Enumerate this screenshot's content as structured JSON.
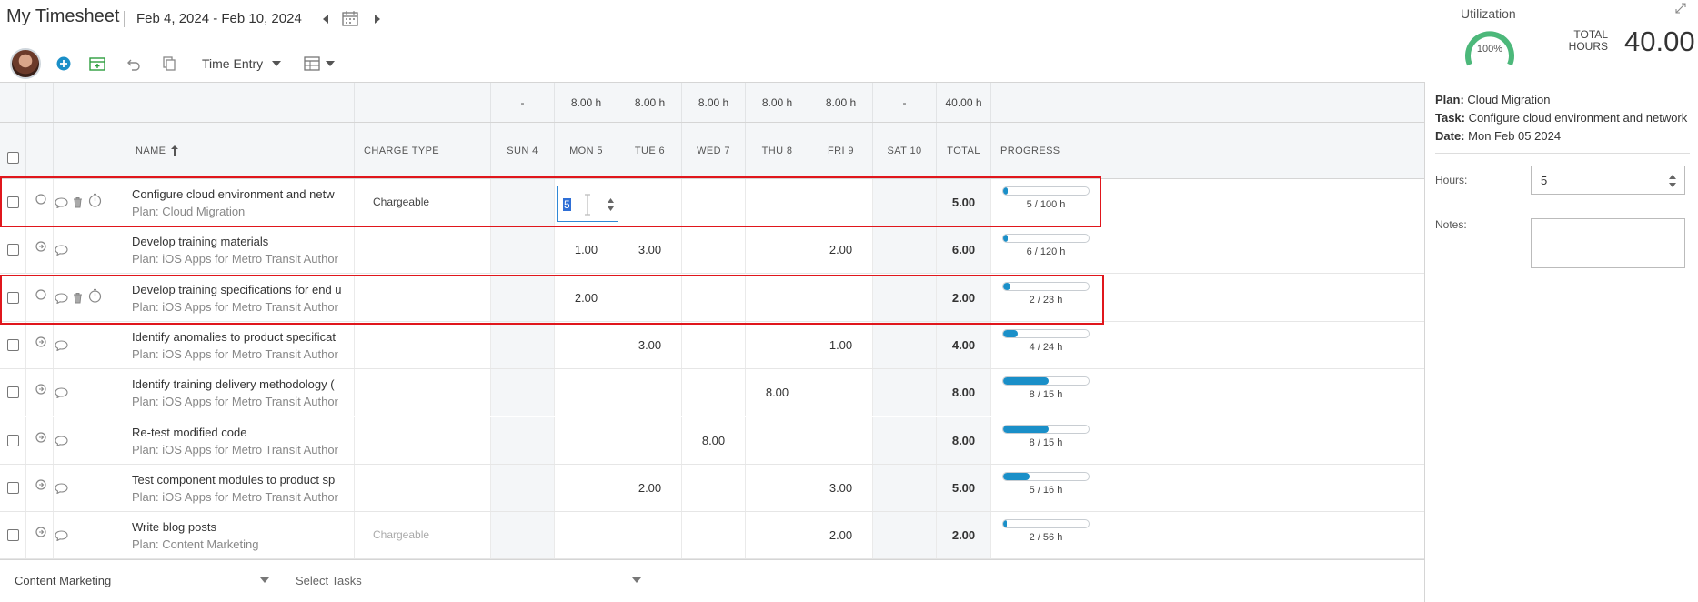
{
  "header": {
    "title": "My Timesheet",
    "date_range": "Feb 4, 2024 - Feb 10, 2024"
  },
  "toolbar": {
    "view_label": "Time Entry"
  },
  "utilization": {
    "label": "Utilization",
    "percent": "100%",
    "total_label_1": "TOTAL",
    "total_label_2": "HOURS",
    "total_value": "40.00"
  },
  "grid": {
    "day_totals": [
      "-",
      "8.00 h",
      "8.00 h",
      "8.00 h",
      "8.00 h",
      "8.00 h",
      "-",
      "40.00 h"
    ],
    "columns": {
      "name": "NAME",
      "charge_type": "CHARGE TYPE",
      "sun": "SUN 4",
      "mon": "MON 5",
      "tue": "TUE 6",
      "wed": "WED 7",
      "thu": "THU 8",
      "fri": "FRI 9",
      "sat": "SAT 10",
      "total": "TOTAL",
      "progress": "PROGRESS"
    },
    "rows": [
      {
        "name": "Configure cloud environment and netw",
        "plan": "Plan: Cloud Migration",
        "charge": "Chargeable",
        "mon": "5",
        "tue": "",
        "wed": "",
        "thu": "",
        "fri": "",
        "total": "5.00",
        "progress": "5 / 100 h",
        "progress_value": 0.05
      },
      {
        "name": "Develop training materials",
        "plan": "Plan: iOS Apps for Metro Transit Author",
        "charge": "",
        "mon": "1.00",
        "tue": "3.00",
        "wed": "",
        "thu": "",
        "fri": "2.00",
        "total": "6.00",
        "progress": "6 / 120 h",
        "progress_value": 0.05
      },
      {
        "name": "Develop training specifications for end u",
        "plan": "Plan: iOS Apps for Metro Transit Author",
        "charge": "",
        "mon": "2.00",
        "tue": "",
        "wed": "",
        "thu": "",
        "fri": "",
        "total": "2.00",
        "progress": "2 / 23 h",
        "progress_value": 0.087
      },
      {
        "name": "Identify anomalies to product specificat",
        "plan": "Plan: iOS Apps for Metro Transit Author",
        "charge": "",
        "mon": "",
        "tue": "3.00",
        "wed": "",
        "thu": "",
        "fri": "1.00",
        "total": "4.00",
        "progress": "4 / 24 h",
        "progress_value": 0.167
      },
      {
        "name": "Identify training delivery methodology (",
        "plan": "Plan: iOS Apps for Metro Transit Author",
        "charge": "",
        "mon": "",
        "tue": "",
        "wed": "",
        "thu": "8.00",
        "fri": "",
        "total": "8.00",
        "progress": "8 / 15 h",
        "progress_value": 0.533
      },
      {
        "name": "Re-test modified code",
        "plan": "Plan: iOS Apps for Metro Transit Author",
        "charge": "",
        "mon": "",
        "tue": "",
        "wed": "8.00",
        "thu": "",
        "fri": "",
        "total": "8.00",
        "progress": "8 / 15 h",
        "progress_value": 0.533
      },
      {
        "name": "Test component modules to product sp",
        "plan": "Plan: iOS Apps for Metro Transit Author",
        "charge": "",
        "mon": "",
        "tue": "2.00",
        "wed": "",
        "thu": "",
        "fri": "3.00",
        "total": "5.00",
        "progress": "5 / 16 h",
        "progress_value": 0.3125
      },
      {
        "name": "Write blog posts",
        "plan": "Plan: Content Marketing",
        "charge": "Chargeable",
        "mon": "",
        "tue": "",
        "wed": "",
        "thu": "",
        "fri": "2.00",
        "total": "2.00",
        "progress": "2 / 56 h",
        "progress_value": 0.036
      }
    ]
  },
  "footer": {
    "plan_select": "Content Marketing",
    "task_select": "Select Tasks"
  },
  "panel": {
    "plan_label": "Plan:",
    "plan_value": "Cloud Migration",
    "task_label": "Task:",
    "task_value": "Configure cloud environment and network",
    "date_label": "Date:",
    "date_value": "Mon Feb 05 2024",
    "hours_label": "Hours:",
    "hours_value": "5",
    "notes_label": "Notes:"
  },
  "colors": {
    "accent": "#1a8fc8",
    "highlight": "#e0161c",
    "header_bg": "#f4f6f8"
  }
}
